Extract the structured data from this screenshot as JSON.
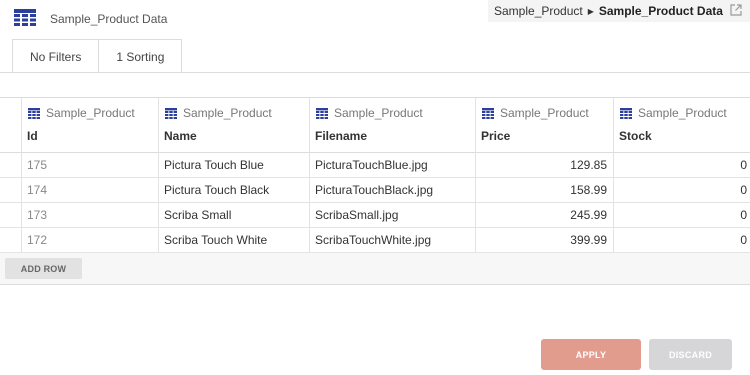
{
  "header": {
    "title": "Sample_Product Data",
    "icon": "table-icon"
  },
  "breadcrumb": {
    "parent": "Sample_Product",
    "current": "Sample_Product Data"
  },
  "tabs": [
    {
      "label": "No Filters"
    },
    {
      "label": "1 Sorting"
    }
  ],
  "grid": {
    "columns": [
      {
        "source": "Sample_Product",
        "field": "Id"
      },
      {
        "source": "Sample_Product",
        "field": "Name"
      },
      {
        "source": "Sample_Product",
        "field": "Filename"
      },
      {
        "source": "Sample_Product",
        "field": "Price"
      },
      {
        "source": "Sample_Product",
        "field": "Stock"
      }
    ],
    "rows": [
      {
        "id": "175",
        "name": "Pictura Touch Blue",
        "filename": "PicturaTouchBlue.jpg",
        "price": "129.85",
        "stock": "0"
      },
      {
        "id": "174",
        "name": "Pictura Touch Black",
        "filename": "PicturaTouchBlack.jpg",
        "price": "158.99",
        "stock": "0"
      },
      {
        "id": "173",
        "name": "Scriba Small",
        "filename": "ScribaSmall.jpg",
        "price": "245.99",
        "stock": "0"
      },
      {
        "id": "172",
        "name": "Scriba Touch White",
        "filename": "ScribaTouchWhite.jpg",
        "price": "399.99",
        "stock": "0"
      }
    ],
    "add_row_label": "ADD ROW"
  },
  "actions": {
    "apply_label": "APPLY",
    "discard_label": "DISCARD"
  },
  "colors": {
    "icon_blue": "#2b3f9e",
    "apply": "#e29c8e",
    "discard": "#d6d6d8"
  }
}
